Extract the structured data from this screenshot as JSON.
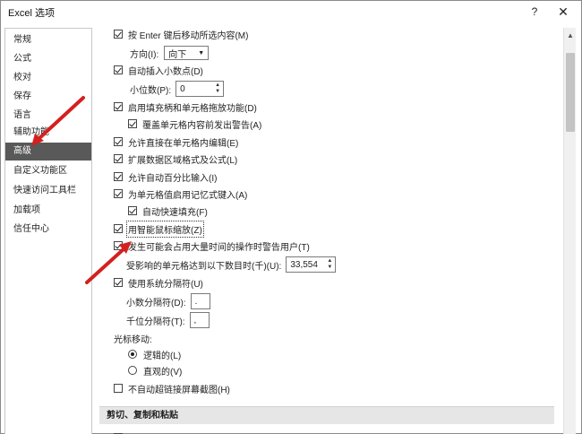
{
  "window": {
    "title": "Excel 选项",
    "help_glyph": "?",
    "close_glyph": "✕"
  },
  "sidebar": {
    "items": [
      {
        "label": "常规"
      },
      {
        "label": "公式"
      },
      {
        "label": "校对"
      },
      {
        "label": "保存"
      },
      {
        "label": "语言"
      },
      {
        "label": "辅助功能"
      },
      {
        "label": "高级",
        "active": true
      },
      {
        "label": "自定义功能区"
      },
      {
        "label": "快速访问工具栏"
      },
      {
        "label": "加载项"
      },
      {
        "label": "信任中心"
      }
    ]
  },
  "options": {
    "enter_move": {
      "label": "按 Enter 键后移动所选内容(M)",
      "checked": true
    },
    "direction": {
      "label": "方向(I):",
      "value": "向下",
      "arrow": "▼"
    },
    "auto_decimal": {
      "label": "自动插入小数点(D)",
      "checked": true
    },
    "decimal_places": {
      "label": "小位数(P):",
      "value": "0"
    },
    "fill_handle": {
      "label": "启用填充柄和单元格拖放功能(D)",
      "checked": true
    },
    "overwrite_alert": {
      "label": "覆盖单元格内容前发出警告(A)",
      "checked": true
    },
    "edit_in_cell": {
      "label": "允许直接在单元格内编辑(E)",
      "checked": true
    },
    "extend_formats": {
      "label": "扩展数据区域格式及公式(L)",
      "checked": true
    },
    "auto_percent": {
      "label": "允许自动百分比输入(I)",
      "checked": true
    },
    "autocomplete": {
      "label": "为单元格值启用记忆式键入(A)",
      "checked": true
    },
    "flash_fill": {
      "label": "自动快速填充(F)",
      "checked": true
    },
    "intellimouse_zoom": {
      "label": "用智能鼠标缩放(Z)",
      "checked": true
    },
    "time_warn": {
      "label": "发生可能会占用大量时间的操作时警告用户(T)",
      "checked": true
    },
    "cells_affected": {
      "label": "受影响的单元格达到以下数目时(千)(U):",
      "value": "33,554"
    },
    "system_separators": {
      "label": "使用系统分隔符(U)",
      "checked": true
    },
    "decimal_separator": {
      "label": "小数分隔符(D):",
      "value": "."
    },
    "thousands_separator": {
      "label": "千位分隔符(T):",
      "value": ","
    },
    "cursor_movement": {
      "label": "光标移动:"
    },
    "logical": {
      "label": "逻辑的(L)",
      "selected": true
    },
    "visual": {
      "label": "直观的(V)",
      "selected": false
    },
    "no_hyperlink_screenshot": {
      "label": "不自动超链接屏幕截图(H)",
      "checked": false
    }
  },
  "section": {
    "cut_copy_paste": "剪切、复制和粘贴"
  },
  "annotation": {
    "arrow_color": "#d42020"
  },
  "colors": {
    "sidebar_active_bg": "#595959",
    "section_bg": "#e6e6e6"
  }
}
